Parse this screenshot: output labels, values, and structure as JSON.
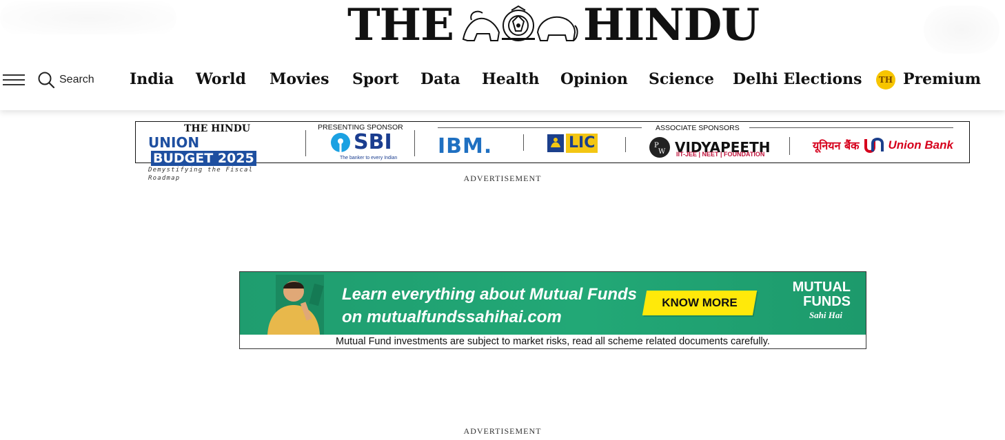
{
  "masthead": {
    "logo_left": "THE",
    "logo_right": "HINDU",
    "menu_icon": "hamburger-icon",
    "search_icon": "search-icon",
    "search_label": "Search"
  },
  "nav": {
    "items": [
      "India",
      "World",
      "Movies",
      "Sport",
      "Data",
      "Health",
      "Opinion",
      "Science",
      "Delhi Elections"
    ],
    "premium_badge": "TH",
    "premium_label": "Premium",
    "premium_badge_color": "#f7c500"
  },
  "sponsor_banner": {
    "brand_logo": "THE HINDU",
    "union": "UNION",
    "budget": "BUDGET 2025",
    "tagline": "Demystifying the Fiscal Roadmap",
    "presenting_caption": "PRESENTING SPONSOR",
    "sbi": "SBI",
    "sbi_tagline": "The banker to every Indian",
    "ibm": "IBM.",
    "lic": "LIC",
    "associate_caption": "ASSOCIATE SPONSORS",
    "vidyapeeth": "VIDYAPEETH",
    "vidyapeeth_sub": "IIT-JEE | NEET | FOUNDATION",
    "union_bank_hindi": "यूनियन बैंक",
    "union_bank": "Union Bank",
    "brand_color": "#1e4fa0"
  },
  "ads": {
    "label_top": "ADVERTISEMENT",
    "label_bottom": "ADVERTISEMENT"
  },
  "mutual_fund_ad": {
    "headline_line1": "Learn everything about Mutual Funds",
    "headline_line2": "on mutualfundssahihai.com",
    "cta": "KNOW MORE",
    "brand_line1": "MUTUAL",
    "brand_line2": "FUNDS",
    "brand_tag": "Sahi Hai",
    "disclaimer": "Mutual Fund investments are subject to market risks, read all scheme related documents carefully.",
    "bg_color": "#22a876",
    "cta_color": "#ffe90a"
  }
}
